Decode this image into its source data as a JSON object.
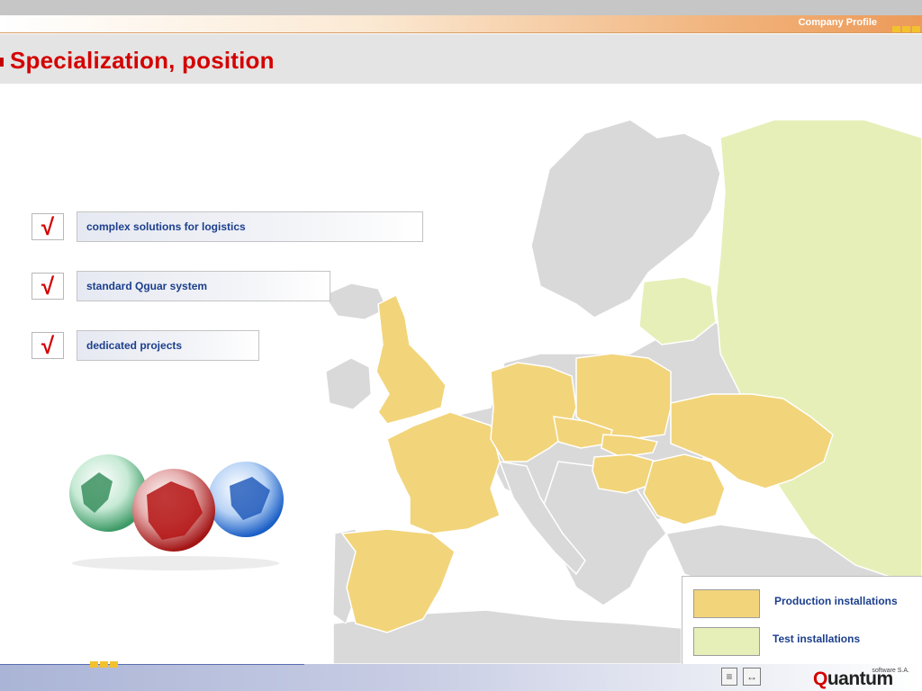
{
  "header": {
    "section_label": "Company Profile",
    "title": "Specialization, position"
  },
  "features": [
    {
      "check": "√",
      "label": "complex solutions for logistics"
    },
    {
      "check": "√",
      "label": "standard Qguar system"
    },
    {
      "check": "√",
      "label": "dedicated projects"
    }
  ],
  "legend": {
    "production": "Production installations",
    "test": "Test installations",
    "production_color": "#f2d47a",
    "test_color": "#e6efb8"
  },
  "footer": {
    "brand_prefix": "Q",
    "brand_rest": "uantum",
    "brand_small": "software S.A."
  },
  "colors": {
    "title_red": "#d40000",
    "label_blue": "#1c3f8c",
    "land_gray": "#d9d9d9",
    "accent_yellow": "#f2c12e"
  },
  "icons": {
    "slide_list": "slide-list-icon",
    "navigation": "navigate-icon"
  }
}
